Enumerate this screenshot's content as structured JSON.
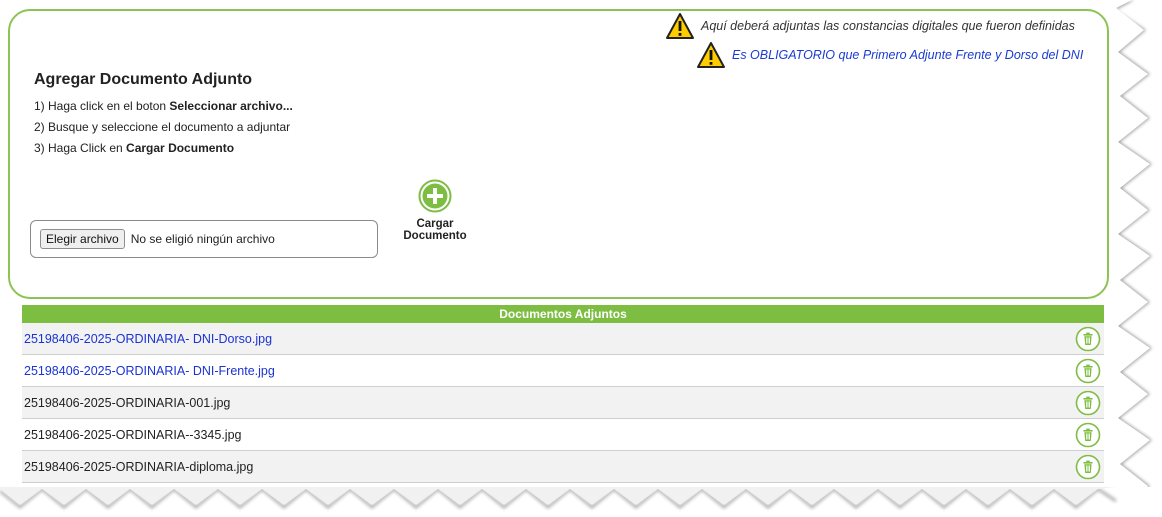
{
  "upload_panel": {
    "warnings": [
      "Aquí deberá adjuntas las constancias digitales que fueron definidas",
      "Es OBLIGATORIO que Primero Adjunte Frente y Dorso del DNI"
    ],
    "heading": "Agregar Documento Adjunto",
    "steps": [
      {
        "prefix": "1) Haga click en el boton ",
        "bold": "Seleccionar archivo..."
      },
      {
        "prefix": "2) Busque y seleccione el documento a adjuntar",
        "bold": ""
      },
      {
        "prefix": "3) Haga Click en ",
        "bold": "Cargar Documento"
      }
    ],
    "file_button_label": "Elegir archivo",
    "file_status": "No se eligió ningún archivo",
    "upload_label_line1": "Cargar",
    "upload_label_line2": "Documento"
  },
  "documents": {
    "header": "Documentos Adjuntos",
    "rows": [
      {
        "name": "25198406-2025-ORDINARIA- DNI-Dorso.jpg",
        "link": true
      },
      {
        "name": "25198406-2025-ORDINARIA- DNI-Frente.jpg",
        "link": true
      },
      {
        "name": "25198406-2025-ORDINARIA-001.jpg",
        "link": false
      },
      {
        "name": "25198406-2025-ORDINARIA--3345.jpg",
        "link": false
      },
      {
        "name": "25198406-2025-ORDINARIA-diploma.jpg",
        "link": false
      }
    ]
  },
  "colors": {
    "accent_green": "#7cbd42",
    "panel_border": "#8dc255",
    "link_blue": "#1a33d6",
    "warning_yellow": "#ffcc00"
  },
  "icons": {
    "warning": "warning-triangle-icon",
    "upload": "plus-circle-icon",
    "delete": "trash-icon"
  }
}
